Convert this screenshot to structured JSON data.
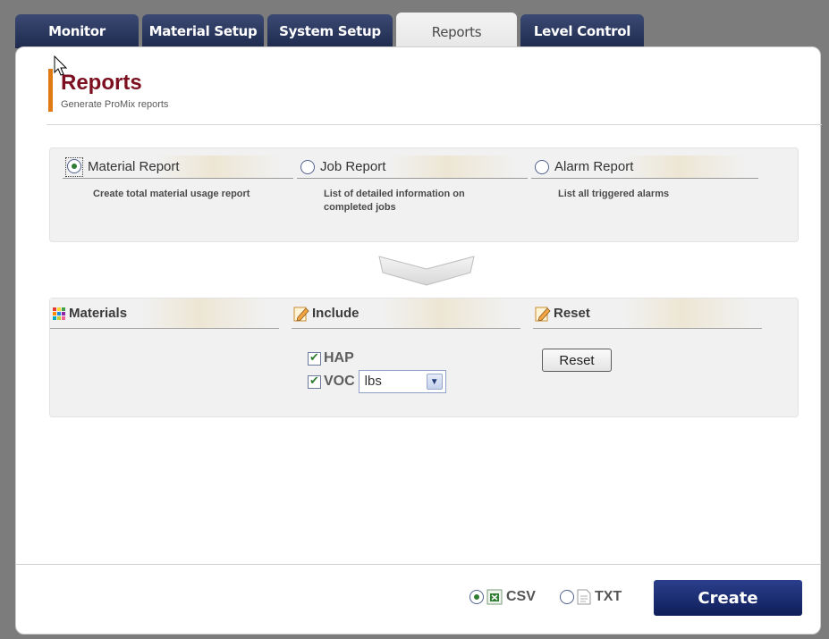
{
  "tabs": [
    {
      "label": "Monitor",
      "active": false
    },
    {
      "label": "Material Setup",
      "active": false
    },
    {
      "label": "System Setup",
      "active": false
    },
    {
      "label": "Reports",
      "active": true
    },
    {
      "label": "Level Control",
      "active": false
    }
  ],
  "header": {
    "title": "Reports",
    "subtitle": "Generate ProMix reports"
  },
  "report_types": [
    {
      "label": "Material Report",
      "description": "Create total material usage report",
      "selected": true
    },
    {
      "label": "Job Report",
      "description": "List of detailed information on completed jobs",
      "selected": false
    },
    {
      "label": "Alarm Report",
      "description": "List all triggered alarms",
      "selected": false
    }
  ],
  "sections": {
    "materials": {
      "title": "Materials"
    },
    "include": {
      "title": "Include",
      "hap_label": "HAP",
      "hap_checked": true,
      "voc_label": "VOC",
      "voc_checked": true,
      "unit_selected": "lbs"
    },
    "reset": {
      "title": "Reset",
      "button_label": "Reset"
    }
  },
  "footer": {
    "csv_label": "CSV",
    "csv_selected": true,
    "txt_label": "TXT",
    "txt_selected": false,
    "create_label": "Create"
  },
  "colors": {
    "title": "#7d1020",
    "accent_bar": "#e07a14",
    "tab_bg": "#1e2a4d",
    "create_bg": "#0f1e5a"
  },
  "icons": {
    "materials": "grid-icon",
    "include": "pencil-note-icon",
    "reset": "pencil-note-icon",
    "csv": "spreadsheet-icon",
    "txt": "document-icon"
  }
}
